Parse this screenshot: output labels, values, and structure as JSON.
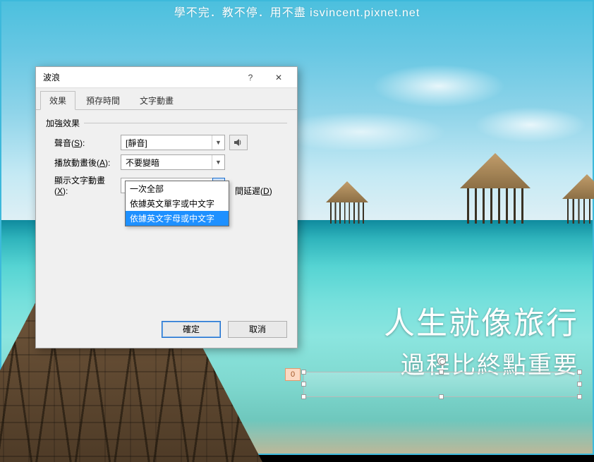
{
  "watermark": "學不完．教不停．用不盡 isvincent.pixnet.net",
  "slide": {
    "line1": "人生就像旅行",
    "line2": "過程比終點重要",
    "anim_tag": "0"
  },
  "dialog": {
    "title": "波浪",
    "help": "?",
    "close": "✕",
    "tabs": [
      "效果",
      "預存時間",
      "文字動畫"
    ],
    "active_tab": 0,
    "section": "加強效果",
    "rows": {
      "sound": {
        "label": "聲音",
        "accel": "S",
        "value": "[靜音]"
      },
      "after": {
        "label": "播放動畫後",
        "accel": "A",
        "value": "不要變暗"
      },
      "animate_text": {
        "label": "顯示文字動畫",
        "accel": "X",
        "value": "依據英文字母或中文字",
        "delay_hint_suffix": "間延遲",
        "delay_accel": "D",
        "options": [
          "一次全部",
          "依據英文單字或中文字",
          "依據英文字母或中文字"
        ],
        "highlighted_option": 2
      }
    },
    "buttons": {
      "ok": "確定",
      "cancel": "取消"
    }
  }
}
